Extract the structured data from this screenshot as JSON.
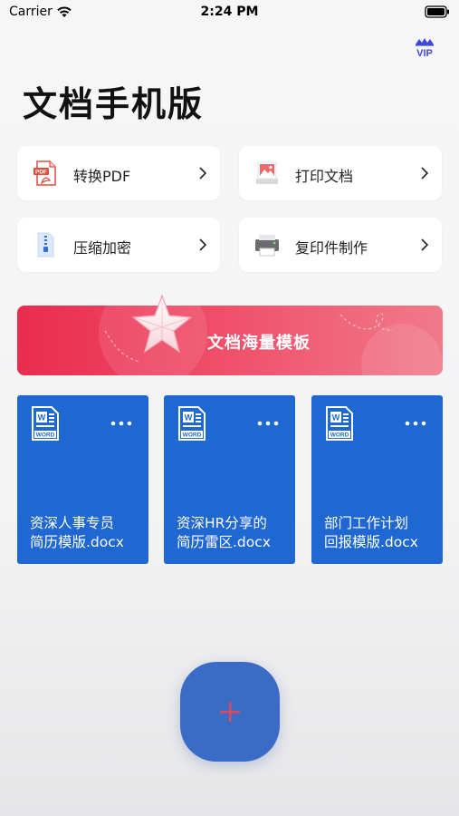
{
  "status_bar": {
    "carrier": "Carrier",
    "time": "2:24 PM"
  },
  "header": {
    "title": "文档手机版",
    "vip_icon": "crown-vip-icon"
  },
  "tools": [
    {
      "label": "转换PDF",
      "icon": "pdf-file-icon"
    },
    {
      "label": "打印文档",
      "icon": "photo-print-icon"
    },
    {
      "label": "压缩加密",
      "icon": "zip-file-icon"
    },
    {
      "label": "复印件制作",
      "icon": "printer-icon"
    }
  ],
  "banner": {
    "label": "文档海量模板",
    "icon": "star-icon"
  },
  "documents": [
    {
      "title": "资深人事专员\n简历模版.docx",
      "icon": "word-file-icon"
    },
    {
      "title": "资深HR分享的\n简历雷区.docx",
      "icon": "word-file-icon"
    },
    {
      "title": "部门工作计划\n回报模版.docx",
      "icon": "word-file-icon"
    }
  ],
  "fab": {
    "icon": "plus-icon"
  },
  "colors": {
    "accent_blue": "#1f67d1",
    "fab_blue": "#3a6cc6",
    "banner_red": "#ea2c4f",
    "plus_red": "#e8455a"
  }
}
